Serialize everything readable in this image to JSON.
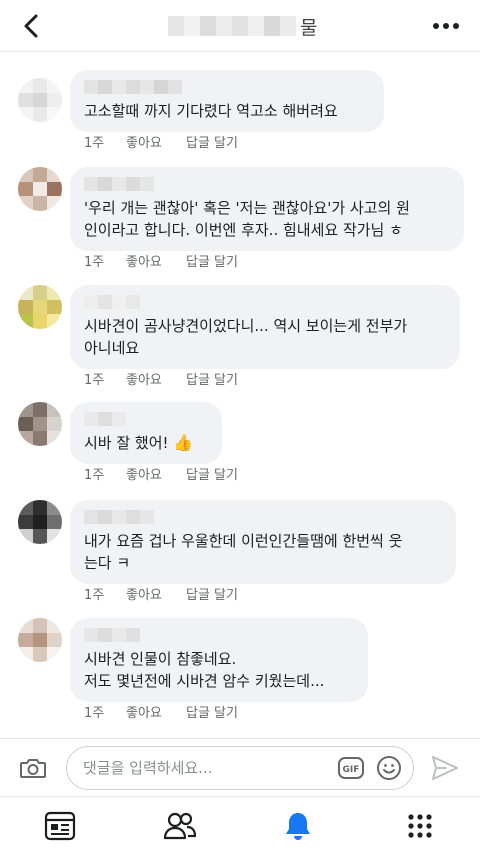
{
  "header": {
    "title": "물",
    "back_icon": "chevron-left-icon",
    "more_icon": "more-horizontal-icon"
  },
  "comments": [
    {
      "text": "고소할때 까지 기다렸다 역고소 해버려요",
      "time": "1주",
      "like": "좋아요",
      "reply": "답글 달기"
    },
    {
      "text": "'우리 개는 괜찮아' 혹은 '저는 괜찮아요'가 사고의 원\n인이라고 합니다. 이번엔 후자.. 힘내세요 작가님 ㅎ",
      "time": "1주",
      "like": "좋아요",
      "reply": "답글 달기"
    },
    {
      "text": "시바견이 곰사냥견이었다니... 역시 보이는게 전부가\n아니네요",
      "time": "1주",
      "like": "좋아요",
      "reply": "답글 달기"
    },
    {
      "text": "시바 잘 했어!",
      "emoji": "👍",
      "time": "1주",
      "like": "좋아요",
      "reply": "답글 달기"
    },
    {
      "text": "내가 요즘 겁나 우울한데 이런인간들땜에 한번씩 웃\n는다 ㅋ",
      "time": "1주",
      "like": "좋아요",
      "reply": "답글 달기"
    },
    {
      "text": "시바견 인물이 참좋네요.\n저도 몇년전에 시바견 암수 키웠는데...",
      "time": "1주",
      "like": "좋아요",
      "reply": "답글 달기"
    }
  ],
  "composer": {
    "placeholder": "댓글을 입력하세요...",
    "camera_icon": "camera-icon",
    "gif_icon": "gif-icon",
    "gif_label": "GIF",
    "emoji_icon": "smiley-icon",
    "send_icon": "send-icon"
  },
  "tabbar": {
    "tabs": [
      {
        "icon": "news-feed-icon",
        "active": false
      },
      {
        "icon": "friends-icon",
        "active": false
      },
      {
        "icon": "notifications-bell-icon",
        "active": true
      },
      {
        "icon": "menu-grid-icon",
        "active": false
      }
    ],
    "active_color": "#1877f2",
    "inactive_color": "#65676b"
  },
  "colors": {
    "bubble": "#f0f2f5",
    "meta_text": "#65676b",
    "accent": "#1877f2"
  }
}
